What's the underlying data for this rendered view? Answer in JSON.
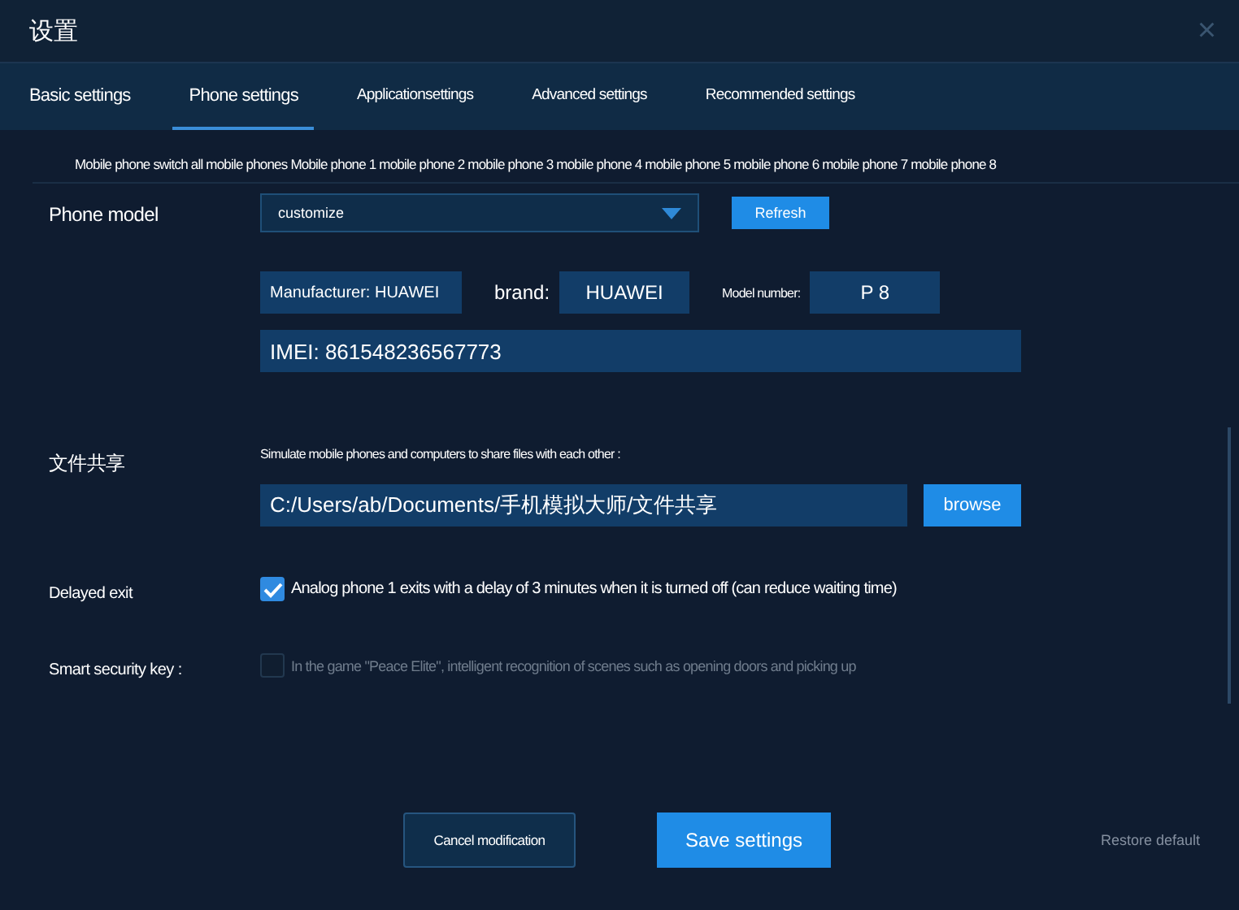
{
  "window": {
    "title": "设置",
    "close": "×"
  },
  "tabs": [
    {
      "label": "Basic settings",
      "selected": false
    },
    {
      "label": "Phone settings",
      "selected": true
    },
    {
      "label": "Applicationsettings",
      "selected": false
    },
    {
      "label": "Advanced settings",
      "selected": false
    },
    {
      "label": "Recommended settings",
      "selected": false
    }
  ],
  "phone_switch": "Mobile phone switch all mobile phones Mobile phone 1 mobile phone 2 mobile phone 3 mobile phone 4 mobile phone 5 mobile phone 6 mobile phone 7 mobile phone 8",
  "phone_model": {
    "label": "Phone model",
    "dropdown": "customize",
    "refresh": "Refresh",
    "manufacturer": "Manufacturer: HUAWEI",
    "brand_label": "brand:",
    "brand": "HUAWEI",
    "model_label": "Model number:",
    "model": "P 8",
    "imei": "IMEI: 861548236567773"
  },
  "file_sharing": {
    "label": "文件共享",
    "hint": "Simulate mobile phones and computers to share files with each other :",
    "path": "C:/Users/ab/Documents/手机模拟大师/文件共享",
    "browse": "browse"
  },
  "options": [
    {
      "label": "Delayed exit",
      "text": "Analog phone 1 exits with a delay of 3 minutes when it is turned off (can reduce waiting time)",
      "checked": true,
      "disabled": false
    },
    {
      "label": "Smart security key :",
      "text": "In the game \"Peace Elite\", intelligent recognition of scenes such as opening doors and picking up",
      "checked": false,
      "disabled": true
    }
  ],
  "buttons": {
    "cancel": "Cancel modification",
    "save": "Save settings",
    "restore": "Restore default"
  }
}
